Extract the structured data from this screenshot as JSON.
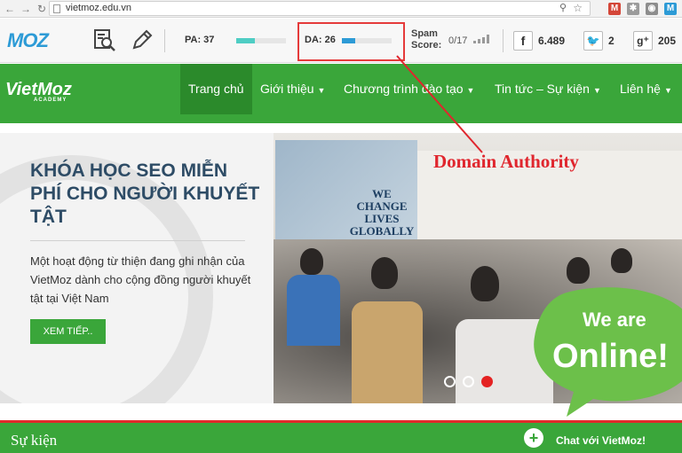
{
  "browser": {
    "url": "vietmoz.edu.vn",
    "icons": [
      "back-icon",
      "forward-icon",
      "reload-icon",
      "zoom-icon",
      "star-icon",
      "gmail-icon",
      "settings-icon",
      "globe-icon",
      "moz-extension-icon"
    ]
  },
  "mozbar": {
    "logo": "MOZ",
    "pa_label": "PA: 37",
    "pa_fraction": 0.37,
    "da_label": "DA: 26",
    "da_fraction": 0.26,
    "spam_label_1": "Spam",
    "spam_label_2": "Score:",
    "spam_value": "0/17",
    "facebook_count": "6.489",
    "twitter_count": "2",
    "gplus_count": "205",
    "accent": "#2d9bd6",
    "bar_color": "#4ecdc4"
  },
  "site": {
    "logo": "VietMoz",
    "logo_sub": "ACADEMY",
    "menu": [
      "Trang chủ",
      "Giới thiệu",
      "Chương trình đào tạo",
      "Tin tức – Sự kiện",
      "Liên hệ"
    ],
    "brand_green": "#3aa63a"
  },
  "hero": {
    "title": "KHÓA HỌC SEO MIỄN PHÍ CHO NGƯỜI KHUYẾT TẬT",
    "description": "Một hoạt động từ thiện đang ghi nhận của VietMoz dành cho cộng đồng người khuyết tật tại Việt Nam",
    "button": "XEM TIẾP..",
    "poster_text": "WE CHANGE LIVES GLOBALLY"
  },
  "annotation": {
    "label": "Domain Authority",
    "color": "#e0262e"
  },
  "badge": {
    "line1": "We are",
    "line2": "Online!"
  },
  "footer": {
    "section_title": "Sự kiện",
    "chat_label": "Chat với VietMoz!"
  }
}
